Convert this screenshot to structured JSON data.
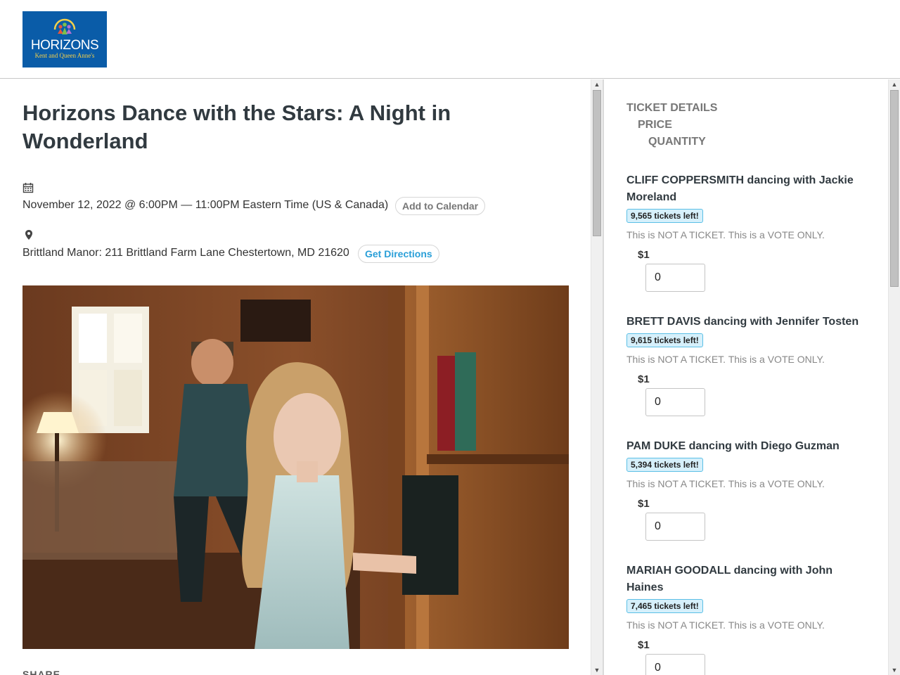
{
  "header": {
    "logo": {
      "title": "HORIZONS",
      "subtitle": "Kent and Queen Anne's",
      "brand_color": "#0a5ca8"
    }
  },
  "event": {
    "title": "Horizons Dance with the Stars: A Night in Wonderland",
    "date_text": "November 12, 2022 @ 6:00PM — 11:00PM Eastern Time (US & Canada)",
    "add_to_calendar_label": "Add to Calendar",
    "address_text": "Brittland Manor: 211 Brittland Farm Lane Chestertown, MD 21620",
    "get_directions_label": "Get Directions",
    "share_label": "SHARE",
    "icons": {
      "calendar": "calendar-icon",
      "location": "map-pin-icon"
    }
  },
  "tickets": {
    "header": {
      "details": "TICKET DETAILS",
      "price": "PRICE",
      "quantity": "QUANTITY"
    },
    "items": [
      {
        "name": "CLIFF COPPERSMITH dancing with Jackie Moreland",
        "remaining": "9,565 tickets left!",
        "note": "This is NOT A TICKET. This is a VOTE ONLY.",
        "price": "$1",
        "quantity": "0"
      },
      {
        "name": "BRETT DAVIS dancing with Jennifer Tosten",
        "remaining": "9,615 tickets left!",
        "note": "This is NOT A TICKET. This is a VOTE ONLY.",
        "price": "$1",
        "quantity": "0"
      },
      {
        "name": "PAM DUKE dancing with Diego Guzman",
        "remaining": "5,394 tickets left!",
        "note": "This is NOT A TICKET. This is a VOTE ONLY.",
        "price": "$1",
        "quantity": "0"
      },
      {
        "name": "MARIAH GOODALL dancing with John Haines",
        "remaining": "7,465 tickets left!",
        "note": "This is NOT A TICKET. This is a VOTE ONLY.",
        "price": "$1",
        "quantity": "0"
      }
    ]
  },
  "colors": {
    "accent": "#2a9fd8",
    "badge_bg": "#d6f0fb",
    "badge_border": "#5bbfe6",
    "title": "#313a40"
  }
}
